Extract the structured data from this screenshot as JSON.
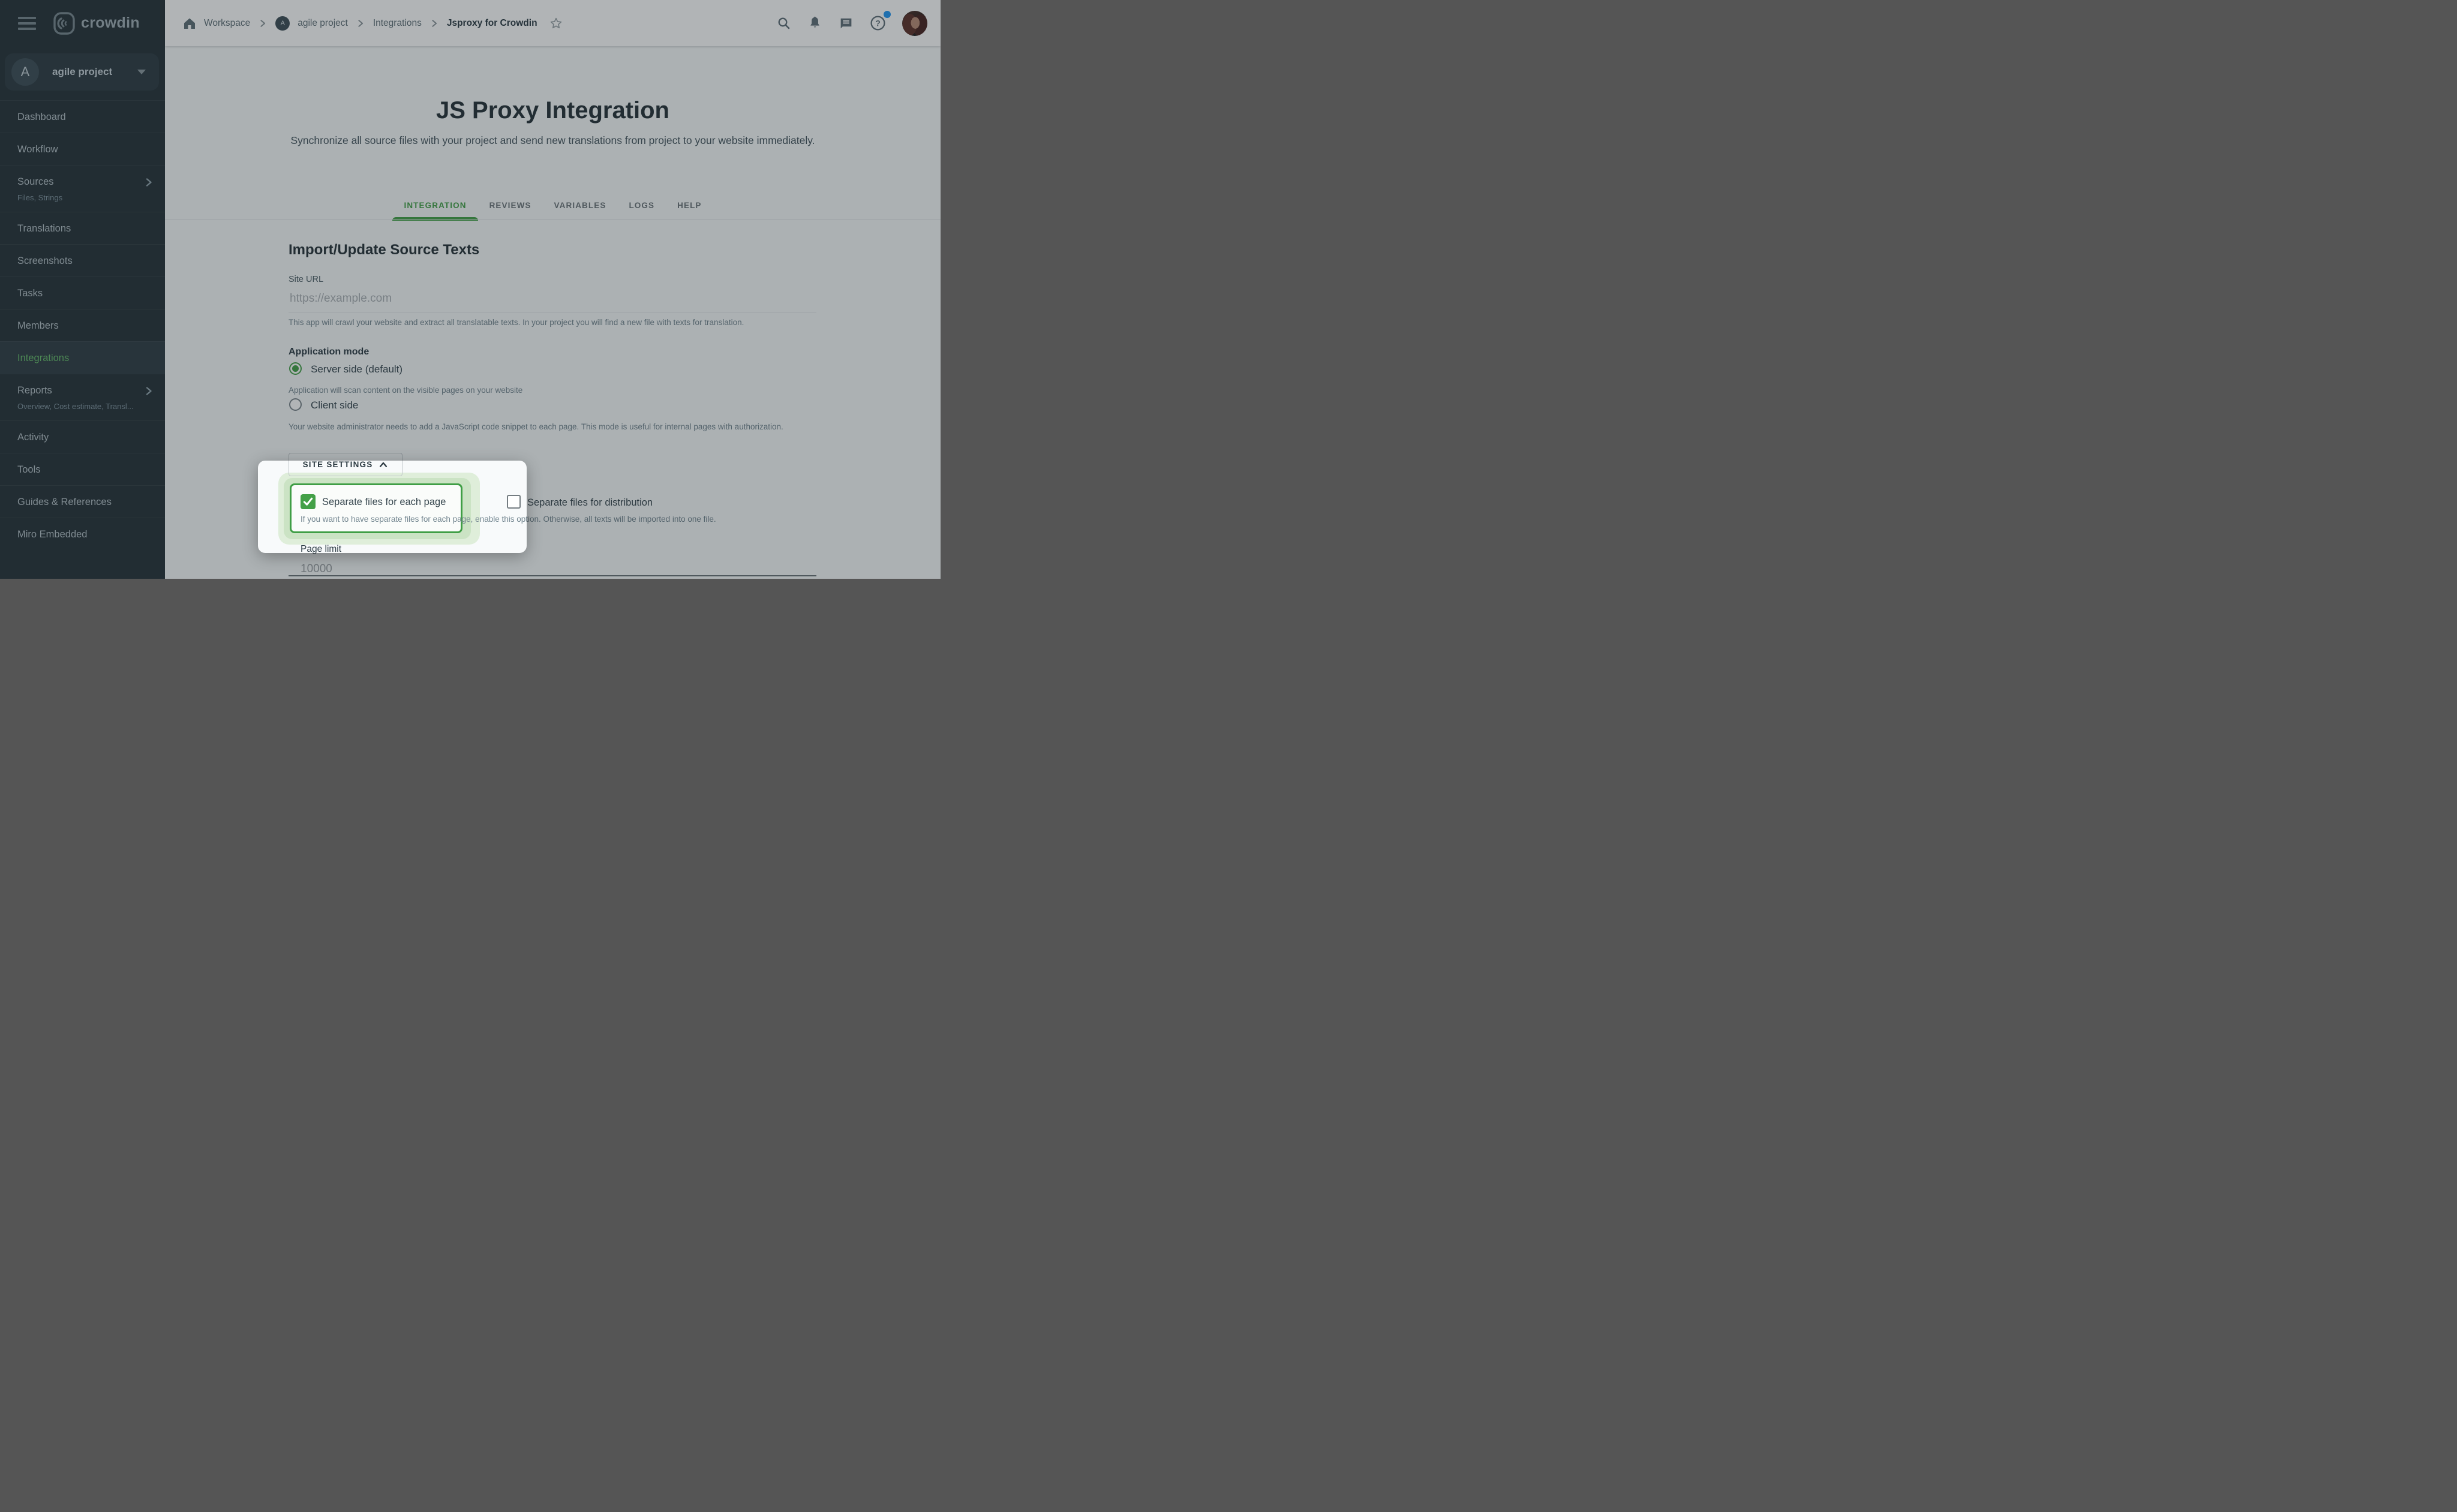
{
  "brand": {
    "name": "crowdin"
  },
  "project": {
    "initial": "A",
    "name": "agile project"
  },
  "sidebar": {
    "items": [
      {
        "label": "Dashboard"
      },
      {
        "label": "Workflow"
      },
      {
        "label": "Sources",
        "subtitle": "Files, Strings",
        "chevron": true
      },
      {
        "label": "Translations"
      },
      {
        "label": "Screenshots"
      },
      {
        "label": "Tasks"
      },
      {
        "label": "Members"
      },
      {
        "label": "Integrations",
        "active": true
      },
      {
        "label": "Reports",
        "subtitle": "Overview, Cost estimate, Transl...",
        "chevron": true
      },
      {
        "label": "Activity"
      },
      {
        "label": "Tools"
      },
      {
        "label": "Guides & References"
      },
      {
        "label": "Miro Embedded"
      }
    ]
  },
  "breadcrumb": {
    "workspace": "Workspace",
    "project_initial": "A",
    "project": "agile project",
    "section": "Integrations",
    "page": "Jsproxy for Crowdin"
  },
  "header_icons": {
    "help_glyph": "?",
    "badge_color": "#2196f3"
  },
  "hero": {
    "title": "JS Proxy Integration",
    "subtitle": "Synchronize all source files with your project and send new translations from project to your website immediately."
  },
  "tabs": [
    {
      "label": "INTEGRATION",
      "active": true
    },
    {
      "label": "REVIEWS"
    },
    {
      "label": "VARIABLES"
    },
    {
      "label": "LOGS"
    },
    {
      "label": "HELP"
    }
  ],
  "form": {
    "section_title": "Import/Update Source Texts",
    "site_url": {
      "label": "Site URL",
      "value": "",
      "placeholder": "https://example.com",
      "help": "This app will crawl your website and extract all translatable texts. In your project you will find a new file with texts for translation."
    },
    "application_mode": {
      "label": "Application mode",
      "options": [
        {
          "label": "Server side (default)",
          "selected": true,
          "help": "Application will scan content on the visible pages on your website"
        },
        {
          "label": "Client side",
          "selected": false,
          "help": "Your website administrator needs to add a JavaScript code snippet to each page. This mode is useful for internal pages with authorization."
        }
      ]
    },
    "site_settings_button": "SITE SETTINGS",
    "separate_files_page": {
      "label": "Separate files for each page",
      "checked": true,
      "help": "If you want to have separate files for each page, enable this option. Otherwise, all texts will be imported into one file."
    },
    "separate_files_distribution": {
      "label": "Separate files for distribution",
      "checked": false
    },
    "page_limit": {
      "label": "Page limit",
      "value": "10000"
    }
  },
  "colors": {
    "accent_green": "#43a047",
    "sidebar_bg": "#263238",
    "overlay": "rgba(30,38,44,0.345)"
  }
}
